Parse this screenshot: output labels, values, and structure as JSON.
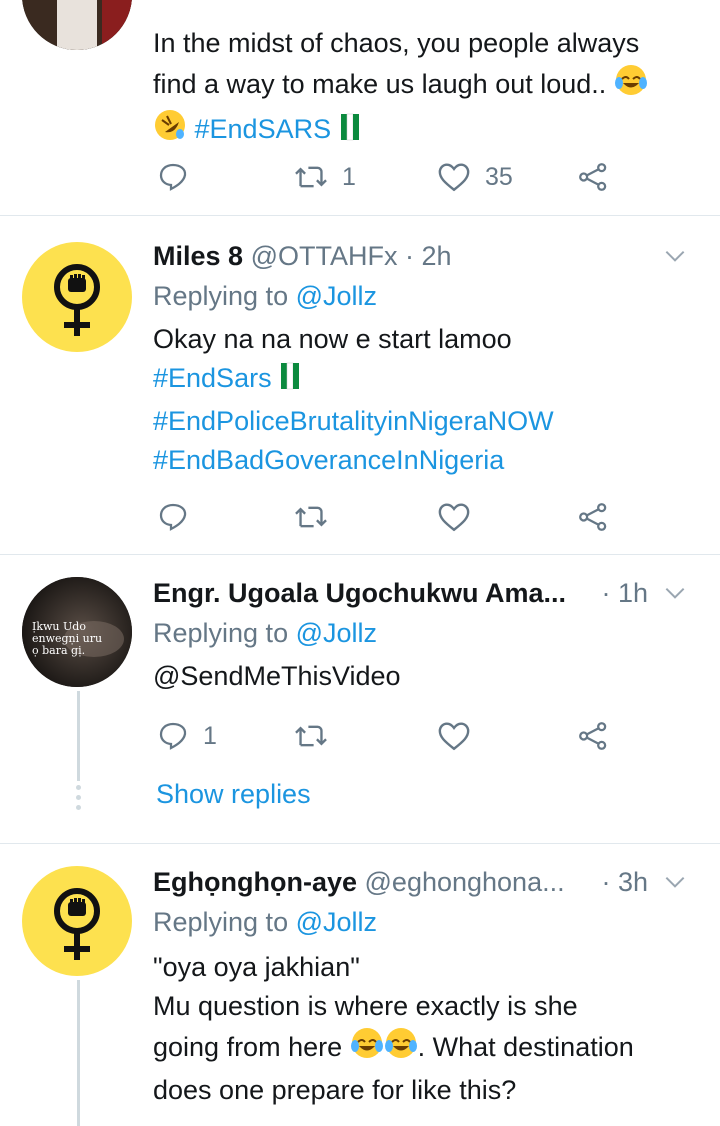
{
  "tweets": [
    {
      "text_line1": "In the midst of chaos, you people always",
      "text_line2": "find a way to make us laugh out loud..",
      "hashtag": "#EndSARS",
      "retweets": "1",
      "likes": "35"
    },
    {
      "name": "Miles 8",
      "handle": "@OTTAHFx",
      "time": "· 2h",
      "replying_prefix": "Replying to",
      "replying_to": "@Jollz",
      "text": "Okay na na now e start lamoo",
      "hashtag1": "#EndSars",
      "hashtag2": "#EndPoliceBrutalityinNigeraNOW",
      "hashtag3": "#EndBadGoveranceInNigeria"
    },
    {
      "name": "Engr. Ugoala Ugochukwu Ama...",
      "time": "· 1h",
      "replying_prefix": "Replying to",
      "replying_to": "@Jollz",
      "mention": "@SendMeThisVideo",
      "replies": "1",
      "avatar_text": "Ịkwu Udo\nenwegṇi uru\nọ bara gị.",
      "show_replies": "Show replies"
    },
    {
      "name": "Eghọnghọn-aye",
      "handle": "@eghonghona...",
      "time": "· 3h",
      "replying_prefix": "Replying to",
      "replying_to": "@Jollz",
      "line1": "\"oya oya jakhian\"",
      "line2": "Mu question is where exactly is she",
      "line3a": "going from here",
      "line3b": ". What destination",
      "line4": "does one prepare for like this?"
    }
  ],
  "colors": {
    "accent": "#1b95e0",
    "secondary_text": "#657786",
    "avatar_yellow": "#fde14f"
  }
}
